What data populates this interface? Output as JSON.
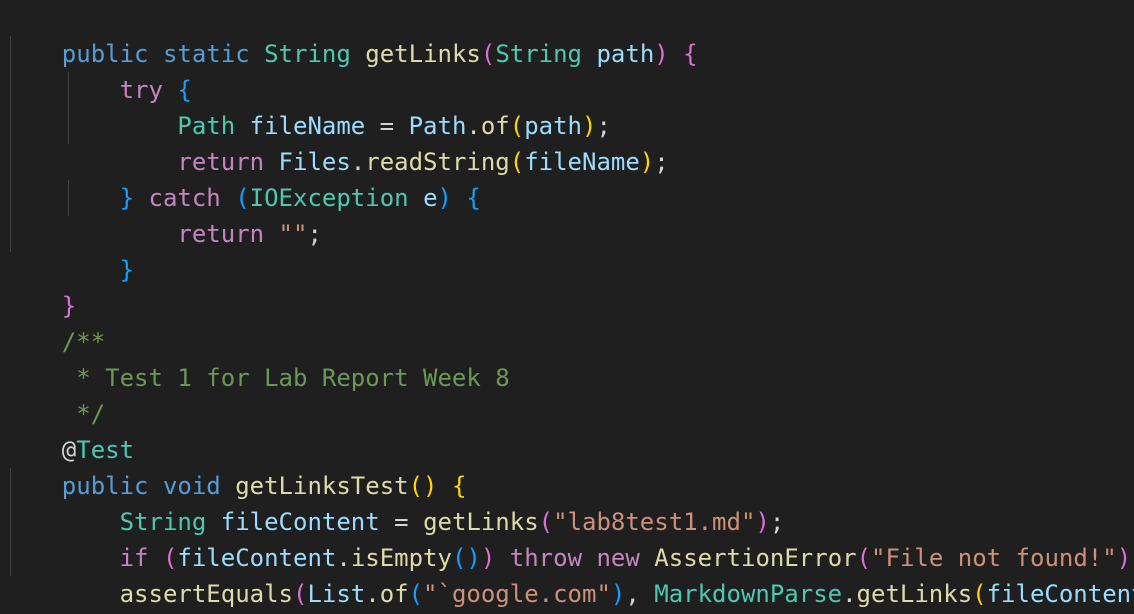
{
  "code": {
    "l1": [
      "public",
      " ",
      "static",
      " ",
      "String",
      " ",
      "getLinks",
      "(",
      "String",
      " ",
      "path",
      ")",
      " ",
      "{"
    ],
    "l2": [
      "    ",
      "try",
      " ",
      "{"
    ],
    "l3": [
      "        ",
      "Path",
      " ",
      "fileName",
      " = ",
      "Path",
      ".",
      "of",
      "(",
      "path",
      ")",
      ";"
    ],
    "l4": [
      "        ",
      "return",
      " ",
      "Files",
      ".",
      "readString",
      "(",
      "fileName",
      ")",
      ";"
    ],
    "l5": [
      "    ",
      "}",
      " ",
      "catch",
      " ",
      "(",
      "IOException",
      " ",
      "e",
      ")",
      " ",
      "{"
    ],
    "l6": [
      "        ",
      "return",
      " ",
      "\"\"",
      ";"
    ],
    "l7": [
      "    ",
      "}"
    ],
    "l8": [
      "}"
    ],
    "l9": [
      "/**"
    ],
    "l10": [
      " * Test 1 for Lab Report Week 8"
    ],
    "l11": [
      " */"
    ],
    "l12": [
      "@",
      "Test"
    ],
    "l13": [
      "public",
      " ",
      "void",
      " ",
      "getLinksTest",
      "(",
      ")",
      " ",
      "{"
    ],
    "l14": [
      "    ",
      "String",
      " ",
      "fileContent",
      " = ",
      "getLinks",
      "(",
      "\"lab8test1.md\"",
      ")",
      ";"
    ],
    "l15": [
      "    ",
      "if",
      " ",
      "(",
      "fileContent",
      ".",
      "isEmpty",
      "(",
      ")",
      ")",
      " ",
      "throw",
      " ",
      "new",
      " ",
      "AssertionError",
      "(",
      "\"File not found!\"",
      ")",
      ";"
    ],
    "l16": [
      "    ",
      "assertEquals",
      "(",
      "List",
      ".",
      "of",
      "(",
      "\"`google.com\"",
      ")",
      ", ",
      "MarkdownParse",
      ".",
      "getLinks",
      "(",
      "fileContent",
      ")",
      ")",
      ";"
    ],
    "l17": [
      "}"
    ]
  },
  "colors": {
    "background": "#1f1f1f",
    "keyword": "#569cd6",
    "type": "#4ec9b0",
    "function": "#dcdcaa",
    "variable": "#9cdcfe",
    "control": "#c586c0",
    "string": "#ce9178",
    "comment": "#6a9955",
    "bracket_gold": "#ffd700",
    "bracket_orchid": "#da70d6",
    "bracket_blue": "#179fff"
  }
}
